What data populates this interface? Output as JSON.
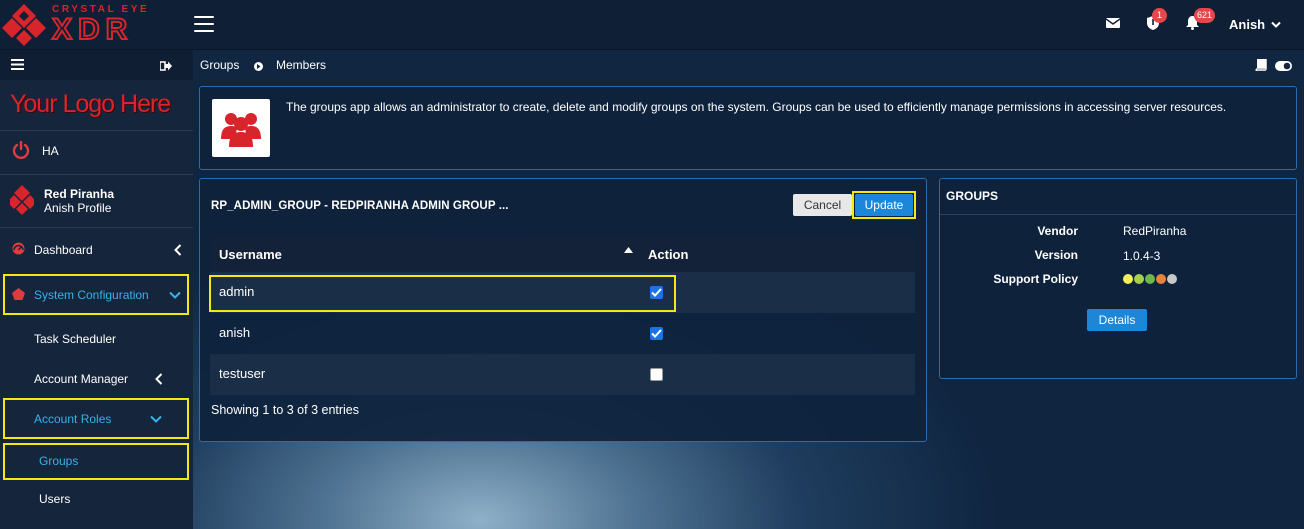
{
  "header": {
    "brand_top": "CRYSTAL EYE",
    "brand_bottom": "XDR",
    "mail_badge": "",
    "shield_badge": "1",
    "bell_badge": "621",
    "user_name": "Anish"
  },
  "sidebar": {
    "logo_text": "Your Logo Here",
    "ha_label": "HA",
    "profile_name": "Red Piranha",
    "profile_sub": "Anish Profile",
    "items": [
      {
        "label": "Dashboard"
      },
      {
        "label": "System Configuration"
      },
      {
        "label": "Task Scheduler"
      },
      {
        "label": "Account Manager"
      },
      {
        "label": "Account Roles"
      },
      {
        "label": "Groups"
      },
      {
        "label": "Users"
      }
    ]
  },
  "breadcrumb": {
    "first": "Groups",
    "second": "Members"
  },
  "info": {
    "text": "The groups app allows an administrator to create, delete and modify groups on the system. Groups can be used to efficiently manage permissions in accessing server resources."
  },
  "group_panel": {
    "title": "RP_ADMIN_GROUP - REDPIRANHA ADMIN GROUP ...",
    "cancel_label": "Cancel",
    "update_label": "Update",
    "columns": {
      "username": "Username",
      "action": "Action"
    },
    "rows": [
      {
        "username": "admin",
        "checked": true
      },
      {
        "username": "anish",
        "checked": true
      },
      {
        "username": "testuser",
        "checked": false
      }
    ],
    "footer": "Showing 1 to 3 of 3 entries"
  },
  "right_panel": {
    "title": "GROUPS",
    "vendor_label": "Vendor",
    "vendor_value": "RedPiranha",
    "version_label": "Version",
    "version_value": "1.0.4-3",
    "support_label": "Support Policy",
    "support_dots": [
      "#f3f056",
      "#a6d04b",
      "#6cb84a",
      "#e5843a",
      "#c8c8c8"
    ],
    "details_label": "Details"
  },
  "colors": {
    "accent": "#36b2ec",
    "highlight": "#f5e711",
    "brand_red": "#d8242b",
    "button_blue": "#1c86d8"
  }
}
